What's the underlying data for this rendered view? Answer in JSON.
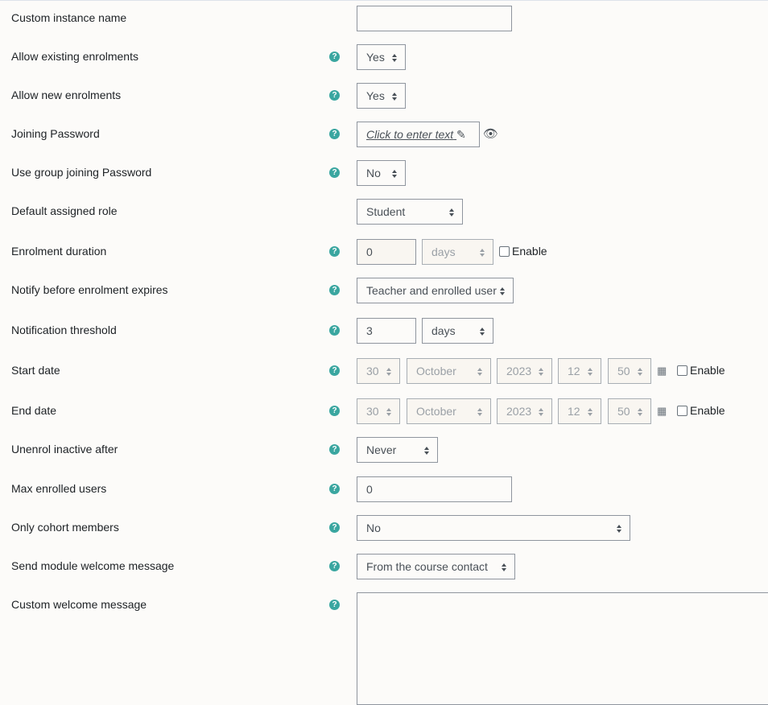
{
  "help_icon": "question-circle-icon",
  "enable_label": "Enable",
  "rows": [
    {
      "label": "Custom instance name",
      "value": ""
    },
    {
      "label": "Allow existing enrolments",
      "value": "Yes"
    },
    {
      "label": "Allow new enrolments",
      "value": "Yes"
    },
    {
      "label": "Joining Password",
      "value": "Click to enter text"
    },
    {
      "label": "Use group joining Password",
      "value": "No"
    },
    {
      "label": "Default assigned role",
      "value": "Student"
    },
    {
      "label": "Enrolment duration",
      "value": "0",
      "unit": "days"
    },
    {
      "label": "Notify before enrolment expires",
      "value": "Teacher and enrolled user"
    },
    {
      "label": "Notification threshold",
      "value": "3",
      "unit": "days"
    },
    {
      "label": "Start date",
      "day": "30",
      "month": "October",
      "year": "2023",
      "hour": "12",
      "minute": "50"
    },
    {
      "label": "End date",
      "day": "30",
      "month": "October",
      "year": "2023",
      "hour": "12",
      "minute": "50"
    },
    {
      "label": "Unenrol inactive after",
      "value": "Never"
    },
    {
      "label": "Max enrolled users",
      "value": "0"
    },
    {
      "label": "Only cohort members",
      "value": "No"
    },
    {
      "label": "Send module welcome message",
      "value": "From the course contact"
    },
    {
      "label": "Custom welcome message",
      "value": ""
    }
  ]
}
